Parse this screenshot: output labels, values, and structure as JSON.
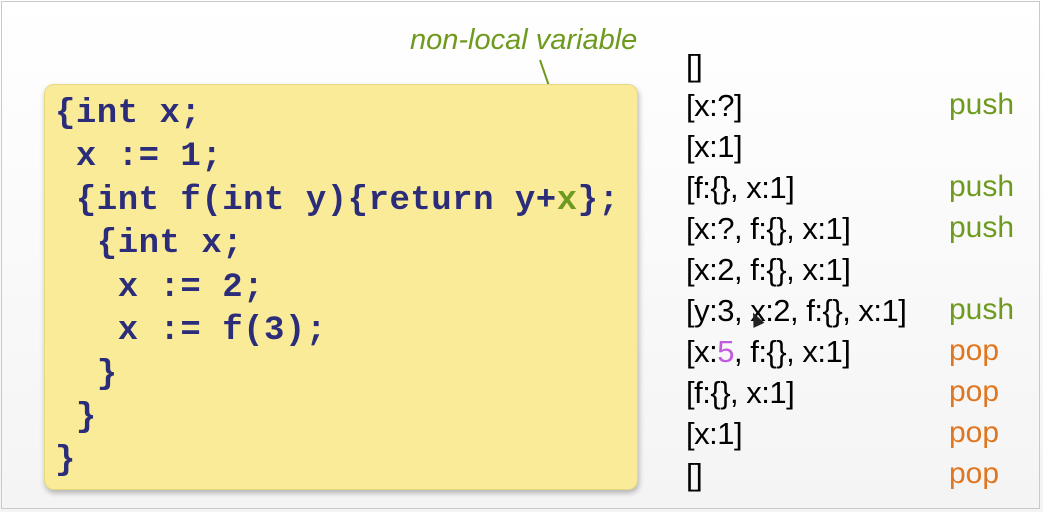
{
  "annotation": "non-local variable",
  "code": [
    {
      "pre": "{int x;",
      "hl": "",
      "post": ""
    },
    {
      "pre": " x := 1;",
      "hl": "",
      "post": ""
    },
    {
      "pre": " {int f(int y){return y+",
      "hl": "x",
      "post": "};"
    },
    {
      "pre": "  {int x;",
      "hl": "",
      "post": ""
    },
    {
      "pre": "   x := 2;",
      "hl": "",
      "post": ""
    },
    {
      "pre": "   x := f(3);",
      "hl": "",
      "post": ""
    },
    {
      "pre": "  }",
      "hl": "",
      "post": ""
    },
    {
      "pre": " }",
      "hl": "",
      "post": ""
    },
    {
      "pre": "}",
      "hl": "",
      "post": ""
    }
  ],
  "stack": [
    {
      "pre": "[]",
      "hl": "",
      "post": "",
      "op": ""
    },
    {
      "pre": "[x:?]",
      "hl": "",
      "post": "",
      "op": "push"
    },
    {
      "pre": "[x:1]",
      "hl": "",
      "post": "",
      "op": ""
    },
    {
      "pre": "[f:{}, x:1]",
      "hl": "",
      "post": "",
      "op": "push"
    },
    {
      "pre": "[x:?, f:{}, x:1]",
      "hl": "",
      "post": "",
      "op": "push"
    },
    {
      "pre": "[x:2, f:{}, x:1]",
      "hl": "",
      "post": "",
      "op": ""
    },
    {
      "pre": "[y:3, x:2, f:{}, x:1]",
      "hl": "",
      "post": "",
      "op": "push"
    },
    {
      "pre": "[x:",
      "hl": "5",
      "post": ", f:{}, x:1]",
      "op": "pop"
    },
    {
      "pre": "[f:{}, x:1]",
      "hl": "",
      "post": "",
      "op": "pop"
    },
    {
      "pre": "[x:1]",
      "hl": "",
      "post": "",
      "op": "pop"
    },
    {
      "pre": "[]",
      "hl": "",
      "post": "",
      "op": "pop"
    }
  ],
  "colors": {
    "code": "#2b2d7a",
    "highlight": "#6e9a1e",
    "push": "#6e9a1e",
    "pop": "#e0761f",
    "value": "#c35be0",
    "box": "#faeb98"
  }
}
